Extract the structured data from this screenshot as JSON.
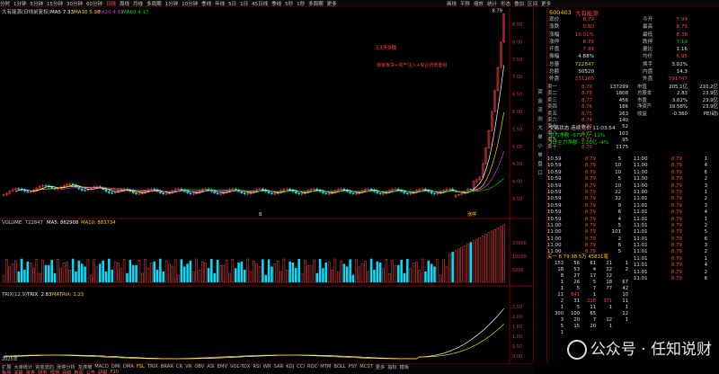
{
  "tabs": [
    "分时",
    "1分钟",
    "5分钟",
    "15分钟",
    "30分钟",
    "60分钟",
    "日线",
    "周线",
    "月线",
    "多周期",
    "1分钟",
    "10分钟",
    "季线",
    "年线",
    "5日",
    "1日",
    "45日线",
    "季线",
    "5秒",
    "1秒",
    "多周期",
    "更多"
  ],
  "active_tab_index": 6,
  "toolbar_tools": [
    "画线",
    "平移",
    "缩放",
    "统计",
    "形态",
    "叠加",
    "区间",
    "更多"
  ],
  "main_indicator": {
    "name": "大有能源(日线前复权)",
    "ma5": "MA5 7.33",
    "ma10": "MA10 5.98",
    "ma20": "MA20 4.91",
    "ma60": "MA60 4.17"
  },
  "price_axis": [
    "8.50",
    "8.00",
    "7.50",
    "7.00",
    "6.50",
    "6.00",
    "5.50",
    "5.00",
    "4.50",
    "4.00",
    "3.50"
  ],
  "main_labels": {
    "peak_price": "8.79",
    "low_price": "3.40",
    "annotation_main": "13天9板",
    "annotation_red": "煤炭板块+资产注入+央企背景重组",
    "label_buy": "B",
    "label_sell": "涨停"
  },
  "volume_indicator": {
    "title": "VOLUME: 722847",
    "ma5": "MA5: 862908",
    "ma10": "MA10: 883734",
    "axis": [
      "15000",
      "10000",
      "5000"
    ]
  },
  "trix_indicator": {
    "title": "TRIX(12,9)",
    "trix": "TRIX: 2.83",
    "matrix": "MATRIX: 1.23",
    "axis": [
      "2.50",
      "2.00",
      "1.50",
      "1.00",
      "0.50",
      "0.00"
    ]
  },
  "bottom_bar": [
    "扩展",
    "大单统计",
    "资金流向",
    "涨停分析",
    "龙虎榜",
    "MACD",
    "DMI",
    "DMA",
    "FSL",
    "TRIX",
    "BRAR",
    "CR",
    "VR",
    "OBV",
    "ASI",
    "EMV",
    "VOL-TDX",
    "RSI",
    "WR",
    "SAR",
    "KDJ",
    "CCI",
    "ROC",
    "MTM",
    "BOLL",
    "PSY",
    "MCST",
    "更多",
    "指标",
    "模板"
  ],
  "bottom_tabs": [
    "板块",
    "关联",
    "资金",
    "财务",
    "预测",
    "评级",
    "新闻",
    "公告",
    "研报",
    "F10"
  ],
  "sidebar_labels": [
    "资",
    "金",
    "流",
    "向",
    "大",
    "单",
    "小",
    "单",
    "盘",
    "口"
  ],
  "quote": {
    "code": "600403",
    "name": "大有能源",
    "left": [
      {
        "label": "现价",
        "value": "8.79",
        "c": "rv"
      },
      {
        "label": "涨跌",
        "value": "0.80",
        "c": "rv"
      },
      {
        "label": "涨幅",
        "value": "10.01%",
        "c": "rv"
      },
      {
        "label": "涨停",
        "value": "8.79",
        "c": "rv"
      },
      {
        "label": "开盘",
        "value": "7.99",
        "c": "rv"
      },
      {
        "label": "振幅",
        "value": "4.88%",
        "c": "wv"
      },
      {
        "label": "总量",
        "value": "722847",
        "c": "yv"
      },
      {
        "label": "总额",
        "value": "50520",
        "c": "wv"
      },
      {
        "label": "外盘",
        "value": "331100",
        "c": "rv"
      }
    ],
    "right": [
      {
        "label": "今开",
        "value": "7.99",
        "c": "rv"
      },
      {
        "label": "最高",
        "value": "8.79",
        "c": "rv"
      },
      {
        "label": "最低",
        "value": "8.38",
        "c": "rv"
      },
      {
        "label": "跌停",
        "value": "7.19",
        "c": "gv"
      },
      {
        "label": "量比",
        "value": "1.16",
        "c": "wv"
      },
      {
        "label": "均价",
        "value": "6.95",
        "c": "rv"
      },
      {
        "label": "换手",
        "value": "3.02%",
        "c": "wv"
      },
      {
        "label": "内盘",
        "value": "14.3",
        "c": "wv"
      },
      {
        "label": "外盘",
        "value": "391747",
        "c": "rv"
      }
    ]
  },
  "buy_sell": [
    {
      "lbl": "卖一",
      "p": "8.79",
      "v": "137299",
      "c": "rv"
    },
    {
      "lbl": "卖二",
      "p": "8.78",
      "v": "1808",
      "c": "rv"
    },
    {
      "lbl": "卖三",
      "p": "8.77",
      "v": "456",
      "c": "rv"
    },
    {
      "lbl": "卖四",
      "p": "8.76",
      "v": "186",
      "c": "rv"
    },
    {
      "lbl": "卖五",
      "p": "8.75",
      "v": "263",
      "c": "rv"
    },
    {
      "lbl": "卖六",
      "p": "8.74",
      "v": "140",
      "c": "rv"
    },
    {
      "lbl": "卖七",
      "p": "8.73",
      "v": "52",
      "c": "rv"
    },
    {
      "lbl": "卖八",
      "p": "8.72",
      "v": "103",
      "c": "rv"
    },
    {
      "lbl": "卖九",
      "p": "8.71",
      "v": "95",
      "c": "rv"
    },
    {
      "lbl": "卖十",
      "p": "8.70",
      "v": "1175",
      "c": "rv"
    }
  ],
  "finance": [
    {
      "lbl": "市值",
      "p": "205.1亿",
      "v": "210.2亿"
    },
    {
      "lbl": "总股本",
      "p": "2.83",
      "v": "23.9亿"
    },
    {
      "lbl": "市盈",
      "p": "3.02%",
      "v": "23.9亿"
    },
    {
      "lbl": "净资产",
      "p": "19.58%",
      "v": "23.9亿"
    },
    {
      "lbl": "收益",
      "p": "-0.360",
      "v": "PE(动)"
    }
  ],
  "status": {
    "line1": "交易状态:连续竞价 11:03:54",
    "line2": "主力净额 -6797万 -11%",
    "line3": "5日主力净额 -1.20亿 -4%"
  },
  "ticks": [
    [
      "10:59",
      "8.79",
      "5"
    ],
    [
      "10:59",
      "8.79",
      "10"
    ],
    [
      "10:59",
      "8.79",
      "10"
    ],
    [
      "10:59",
      "8.79",
      "5"
    ],
    [
      "10:59",
      "8.79",
      "10"
    ],
    [
      "10:59",
      "8.79",
      "22"
    ],
    [
      "10:59",
      "8.79",
      "32"
    ],
    [
      "10:59",
      "8.79",
      "9"
    ],
    [
      "10:59",
      "8.79",
      "6"
    ],
    [
      "10:59",
      "8.79",
      "4"
    ],
    [
      "11:00",
      "8.79",
      "5"
    ],
    [
      "11:00",
      "8.79",
      "101"
    ],
    [
      "11:00",
      "8.79",
      "2"
    ],
    [
      "11:00",
      "8.79",
      "6"
    ],
    [
      "11:00",
      "8.79",
      "5"
    ],
    [
      "11:00",
      "8.79",
      "3"
    ],
    [
      "11:00",
      "8.79",
      "14"
    ],
    [
      "11:00",
      "8.79",
      "1"
    ],
    [
      "11:00",
      "8.79",
      "10"
    ],
    [
      "11:00",
      "8.79",
      "3"
    ],
    [
      "11:00",
      "8.79",
      "1"
    ],
    [
      "11:00",
      "8.79",
      "4"
    ],
    [
      "11:00",
      "8.79",
      "6"
    ],
    [
      "11:00",
      "8.79",
      "2"
    ],
    [
      "11:00",
      "8.79",
      "3"
    ],
    [
      "11:00",
      "8.79",
      "1"
    ],
    [
      "11:01",
      "8.79",
      "2"
    ],
    [
      "11:01",
      "8.79",
      "3"
    ],
    [
      "11:01",
      "8.79",
      "4"
    ],
    [
      "11:01",
      "8.79",
      "1"
    ],
    [
      "11:01",
      "8.79",
      "2"
    ],
    [
      "11:01",
      "8.79",
      "5"
    ],
    [
      "11:01",
      "8.79",
      "6"
    ],
    [
      "11:01",
      "8.79",
      "3"
    ],
    [
      "11:01",
      "8.79",
      "2"
    ],
    [
      "11:01",
      "8.79",
      "1"
    ],
    [
      "11:01",
      "8.79",
      "4"
    ],
    [
      "11:01",
      "8.79",
      "2"
    ],
    [
      "11:01",
      "8.79",
      "6"
    ]
  ],
  "buy_queue_title": "买一 8.79 38.5万 45831笔",
  "buy_queue": [
    [
      "153",
      "56",
      "61",
      "21",
      "1"
    ],
    [
      "18",
      "53",
      "4",
      "22",
      "2"
    ],
    [
      "8",
      "27",
      "17",
      "12",
      ""
    ],
    [
      "1",
      "26",
      "5",
      "18",
      "67"
    ],
    [
      "1",
      "5",
      "7",
      "77",
      "42"
    ],
    [
      "11",
      "841",
      "1",
      "",
      "10"
    ],
    [
      "2",
      "31",
      "218",
      "371",
      "11"
    ],
    [
      "1",
      "5",
      "11",
      "1",
      "1"
    ],
    [
      "300",
      "100",
      "65",
      "",
      "12"
    ],
    [
      "3",
      "20",
      "7",
      "12",
      "1"
    ],
    [
      "5",
      "15",
      "20",
      "1",
      ""
    ],
    [
      "1",
      "",
      "",
      "",
      ""
    ]
  ],
  "watermark": "公众号 · 任知说财",
  "date_label": "2025年",
  "colors": {
    "up": "#ff4040",
    "down": "#00e0ff",
    "ma5": "#ffffff",
    "ma10": "#ffd400",
    "ma20": "#d040d0",
    "ma60": "#00d000"
  }
}
